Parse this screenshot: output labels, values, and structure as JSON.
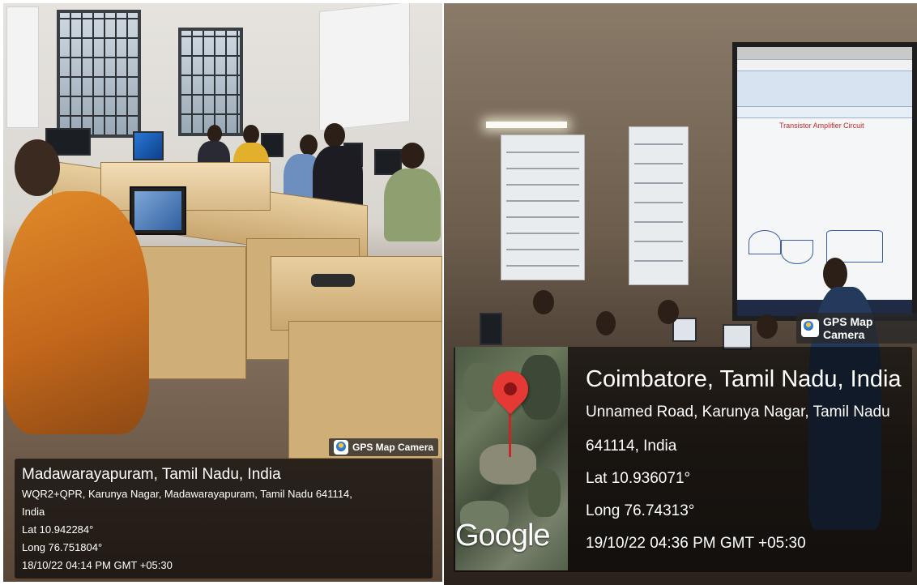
{
  "left_photo": {
    "badge": "GPS Map Camera",
    "location_title": "Madawarayapuram, Tamil Nadu, India",
    "address_line1": "WQR2+QPR, Karunya Nagar, Madawarayapuram, Tamil Nadu 641114,",
    "address_line2": "India",
    "lat": "Lat 10.942284°",
    "long": "Long 76.751804°",
    "timestamp": "18/10/22 04:14 PM GMT +05:30"
  },
  "right_photo": {
    "badge": "GPS Map Camera",
    "location_title": "Coimbatore, Tamil Nadu, India",
    "address_line1": "Unnamed Road, Karunya Nagar, Tamil Nadu",
    "address_line2": "641114, India",
    "lat": "Lat 10.936071°",
    "long": "Long 76.74313°",
    "timestamp": "19/10/22 04:36 PM GMT +05:30",
    "map_logo": "Google",
    "projection_title": "Transistor Amplifier Circuit"
  },
  "icons": [
    "gps-map-camera-icon",
    "map-pin-icon"
  ],
  "colors": {
    "overlay": "#000000",
    "pin": "#e53935",
    "saree": "#e08b2a"
  }
}
